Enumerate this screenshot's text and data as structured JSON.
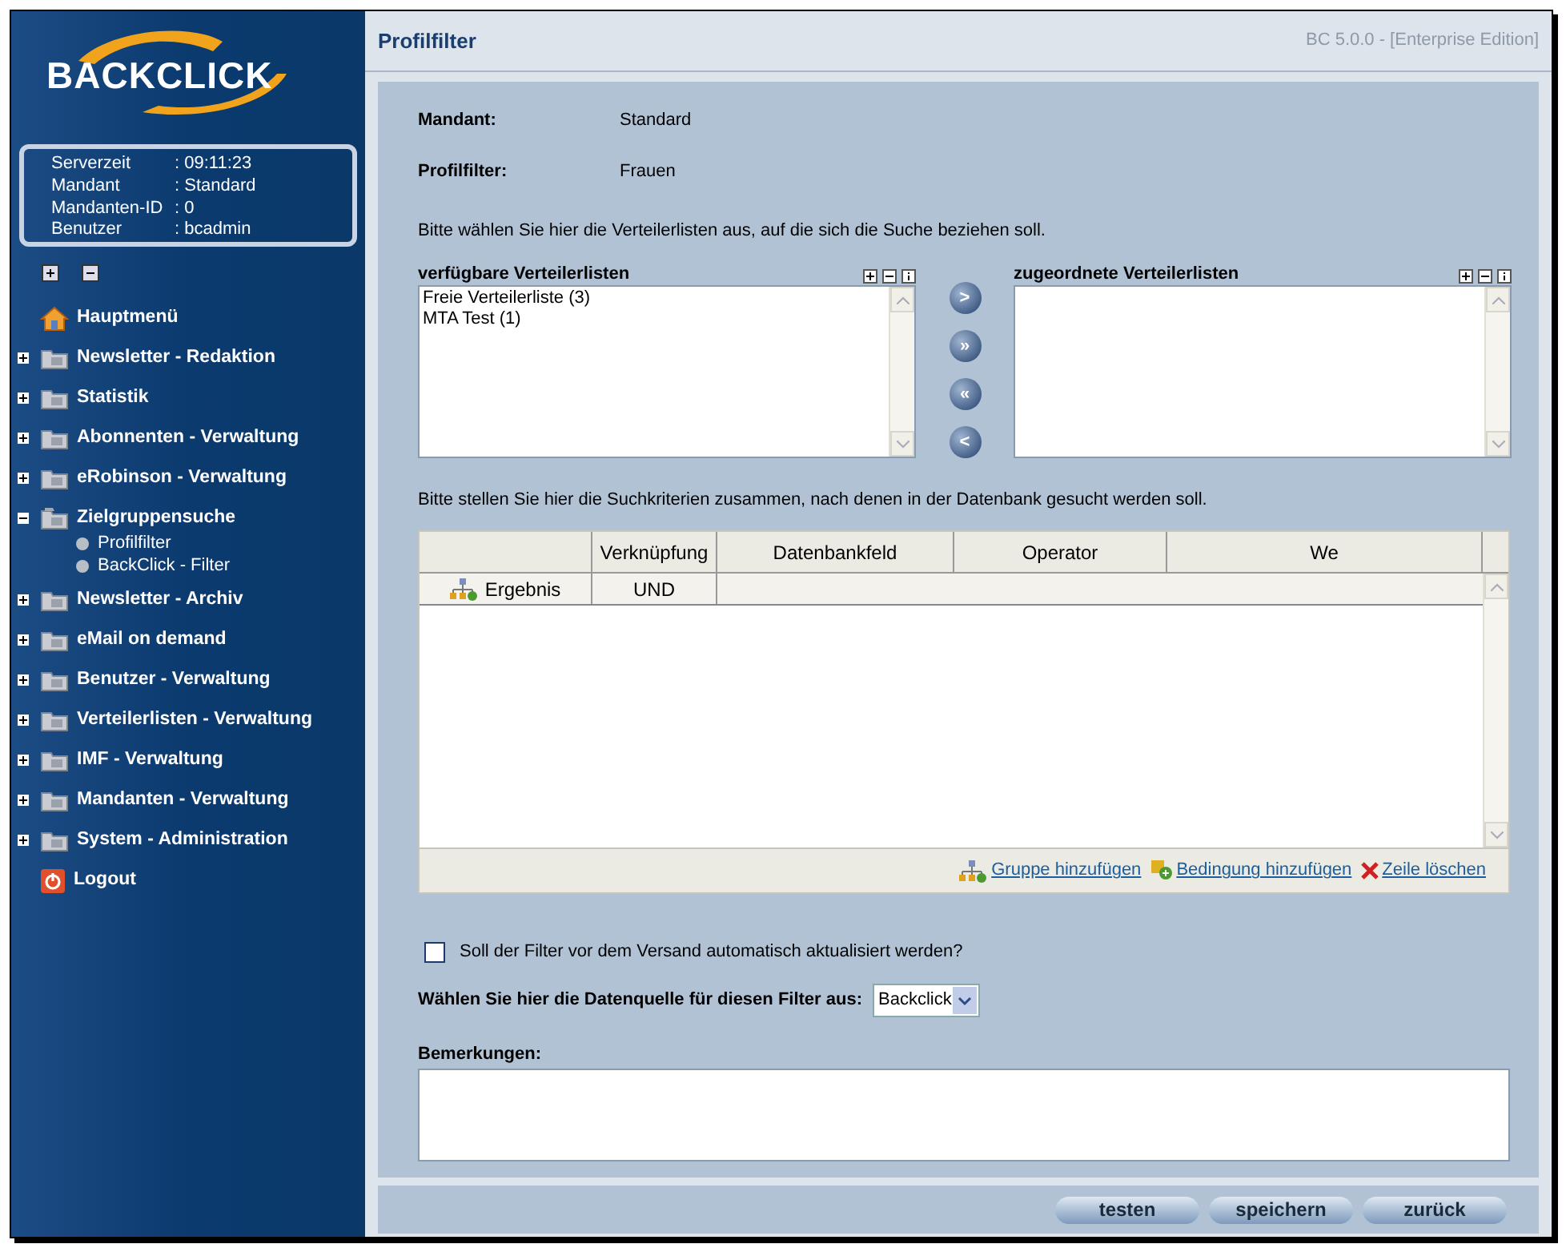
{
  "sidebar": {
    "logo": "BACKCLICK",
    "info": [
      {
        "label": "Serverzeit",
        "value": ": 09:11:23"
      },
      {
        "label": "Mandant",
        "value": ": Standard"
      },
      {
        "label": "Mandanten-ID",
        "value": ": 0"
      },
      {
        "label": "Benutzer",
        "value": ": bcadmin"
      }
    ],
    "items": [
      {
        "kind": "home",
        "label": "Hauptmenü"
      },
      {
        "kind": "folder",
        "label": "Newsletter - Redaktion",
        "expanded": false
      },
      {
        "kind": "folder",
        "label": "Statistik",
        "expanded": false
      },
      {
        "kind": "folder",
        "label": "Abonnenten - Verwaltung",
        "expanded": false
      },
      {
        "kind": "folder",
        "label": "eRobinson - Verwaltung",
        "expanded": false
      },
      {
        "kind": "folder",
        "label": "Zielgruppensuche",
        "expanded": true,
        "children": [
          {
            "label": "Profilfilter"
          },
          {
            "label": "BackClick - Filter"
          }
        ]
      },
      {
        "kind": "folder",
        "label": "Newsletter - Archiv",
        "expanded": false
      },
      {
        "kind": "folder",
        "label": "eMail on demand",
        "expanded": false
      },
      {
        "kind": "folder",
        "label": "Benutzer - Verwaltung",
        "expanded": false
      },
      {
        "kind": "folder",
        "label": "Verteilerlisten - Verwaltung",
        "expanded": false
      },
      {
        "kind": "folder",
        "label": "IMF - Verwaltung",
        "expanded": false
      },
      {
        "kind": "folder",
        "label": "Mandanten - Verwaltung",
        "expanded": false
      },
      {
        "kind": "folder",
        "label": "System - Administration",
        "expanded": false
      },
      {
        "kind": "logout",
        "label": "Logout"
      }
    ]
  },
  "header": {
    "title": "Profilfilter",
    "version": "BC 5.0.0 - [Enterprise Edition]"
  },
  "fields": [
    {
      "label": "Mandant:",
      "value": "Standard"
    },
    {
      "label": "Profilfilter:",
      "value": "Frauen"
    }
  ],
  "lists_hint": "Bitte wählen Sie hier die Verteilerlisten aus, auf die sich die Suche beziehen soll.",
  "available": {
    "title": "verfügbare Verteilerlisten",
    "items": [
      "Freie Verteilerliste (3)",
      "MTA Test (1)"
    ]
  },
  "assigned": {
    "title": "zugeordnete Verteilerlisten"
  },
  "move_buttons": [
    ">",
    "»",
    "«",
    "<"
  ],
  "criteria_hint": "Bitte stellen Sie hier die Suchkriterien zusammen, nach denen in der Datenbank gesucht werden soll.",
  "table": {
    "columns": [
      "Verknüpfung",
      "Datenbankfeld",
      "Operator",
      "We"
    ],
    "rows": [
      {
        "name": "Ergebnis",
        "link": "UND"
      }
    ]
  },
  "table_actions": [
    {
      "kind": "group",
      "label": "Gruppe hinzufügen"
    },
    {
      "kind": "condition",
      "label": "Bedingung hinzufügen"
    },
    {
      "kind": "delete",
      "label": "Zeile löschen"
    }
  ],
  "auto_update": {
    "label": "Soll der Filter vor dem Versand automatisch aktualisiert werden?",
    "checked": false
  },
  "source": {
    "label": "Wählen Sie hier die Datenquelle für diesen Filter aus:",
    "value": "Backclick"
  },
  "remarks": {
    "label": "Bemerkungen:"
  },
  "buttons": [
    "testen",
    "speichern",
    "zurück"
  ]
}
